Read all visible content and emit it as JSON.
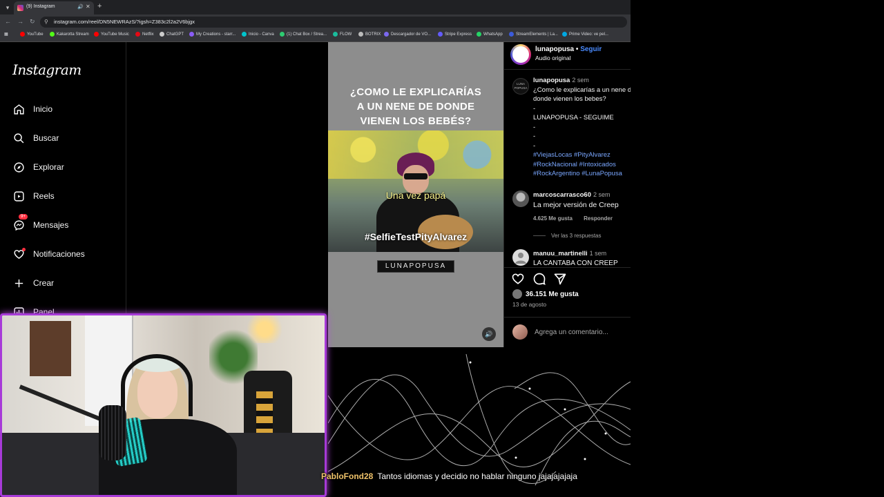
{
  "browser": {
    "tab_title": "(9) Instagram",
    "url": "instagram.com/reel/DN5NEWRAzS/?igsh=Z383c2l2a2V6bjgx",
    "bookmarks": [
      {
        "label": "YouTube",
        "color": "#ff0000"
      },
      {
        "label": "Kakarotta Stream",
        "color": "#53fc18"
      },
      {
        "label": "YouTube Music",
        "color": "#ff0000"
      },
      {
        "label": "Netflix",
        "color": "#e50914"
      },
      {
        "label": "ChatGPT",
        "color": "#cccccc"
      },
      {
        "label": "My Creations - starr...",
        "color": "#8a5cf6"
      },
      {
        "label": "Inicio - Canva",
        "color": "#00c4cc"
      },
      {
        "label": "(1) Chat Box / Strea...",
        "color": "#2ecc71"
      },
      {
        "label": "FLOW",
        "color": "#1abc9c"
      },
      {
        "label": "BOTRIX",
        "color": "#bbbbbb"
      },
      {
        "label": "Descargador de VO...",
        "color": "#7b68ee"
      },
      {
        "label": "Stripe Express",
        "color": "#635bff"
      },
      {
        "label": "WhatsApp",
        "color": "#25d366"
      },
      {
        "label": "StreamElements | La...",
        "color": "#3b5bdb"
      },
      {
        "label": "Prime Video: ve pel...",
        "color": "#00a8e1"
      }
    ]
  },
  "sidebar": {
    "logo": "Instagram",
    "items": [
      {
        "label": "Inicio",
        "icon": "home-icon"
      },
      {
        "label": "Buscar",
        "icon": "search-icon"
      },
      {
        "label": "Explorar",
        "icon": "compass-icon"
      },
      {
        "label": "Reels",
        "icon": "reels-icon"
      },
      {
        "label": "Mensajes",
        "icon": "messenger-icon",
        "badge": "9+"
      },
      {
        "label": "Notificaciones",
        "icon": "heart-icon"
      },
      {
        "label": "Crear",
        "icon": "plus-icon"
      },
      {
        "label": "Panel",
        "icon": "chart-icon"
      }
    ]
  },
  "video": {
    "title_lines": [
      "¿COMO LE EXPLICARÍAS",
      "A UN NENE DE DONDE",
      "VIENEN LOS BEBÉS?"
    ],
    "subtitle": "Una vez papá",
    "hashtag": "#SelfieTestPityAlvarez",
    "brand": "LUNAPOPUSA"
  },
  "post": {
    "username": "lunapopusa",
    "follow_label": "Seguir",
    "audio": "Audio original",
    "caption": {
      "username": "lunapopusa",
      "time": "2 sem",
      "lines": [
        "¿Como le explicarías a un nene de donde vienen los bebes?",
        "-",
        "LUNAPOPUSA - SEGUIME",
        "-",
        "-",
        "-"
      ],
      "hashtags": [
        "#ViejasLocas #PityAlvarez",
        "#RockNacional #Intoxicados",
        "#RockArgentino #LunaPopusa"
      ]
    },
    "comments": [
      {
        "username": "marcoscarrasco60",
        "time": "2 sem",
        "text": "La mejor versión de Creep",
        "likes": "4.625 Me gusta",
        "reply": "Responder",
        "replies": "Ver las 3 respuestas"
      },
      {
        "username": "manuu_martinelli",
        "time": "1 sem",
        "text": "LA CANTABA CON CREEP"
      }
    ],
    "likes": "36.151 Me gusta",
    "date": "13 de agosto",
    "comment_placeholder": "Agrega un comentario..."
  },
  "chat": {
    "user": "PabloFond28",
    "message": "Tantos idiomas y decidio no hablar ninguno jajajajajaja"
  }
}
